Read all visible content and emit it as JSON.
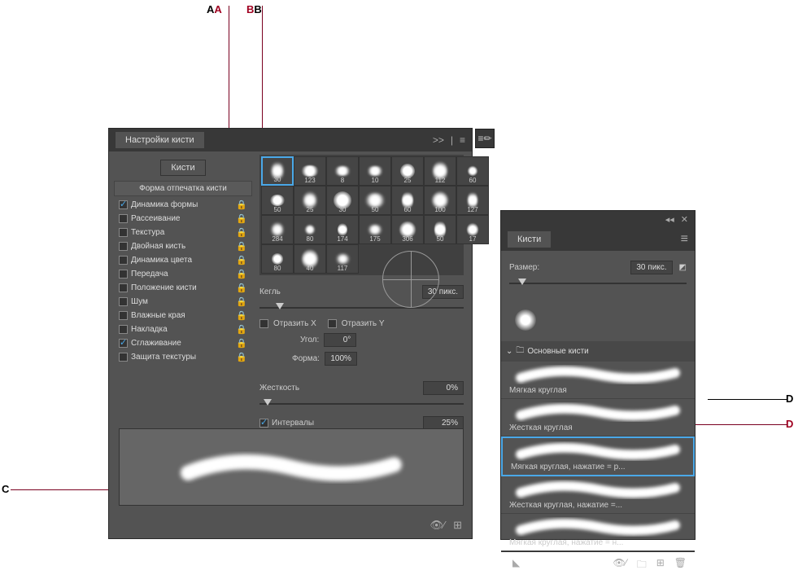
{
  "callouts": {
    "A": "A",
    "B": "B",
    "C": "C",
    "D": "D"
  },
  "panel1": {
    "title": "Настройки кисти",
    "buttons": {
      "kisti": "Кисти"
    },
    "tip_shape": "Форма отпечатка кисти",
    "options": [
      {
        "label": "Динамика формы",
        "checked": true
      },
      {
        "label": "Рассеивание",
        "checked": false
      },
      {
        "label": "Текстура",
        "checked": false
      },
      {
        "label": "Двойная кисть",
        "checked": false
      },
      {
        "label": "Динамика цвета",
        "checked": false
      },
      {
        "label": "Передача",
        "checked": false
      },
      {
        "label": "Положение кисти",
        "checked": false
      },
      {
        "label": "Шум",
        "checked": false
      },
      {
        "label": "Влажные края",
        "checked": false
      },
      {
        "label": "Накладка",
        "checked": false
      },
      {
        "label": "Сглаживание",
        "checked": true
      },
      {
        "label": "Защита текстуры",
        "checked": false
      }
    ],
    "brush_grid": [
      30,
      123,
      8,
      10,
      25,
      112,
      60,
      50,
      25,
      30,
      50,
      60,
      100,
      127,
      284,
      80,
      174,
      175,
      306,
      50,
      17,
      80,
      40,
      117
    ],
    "size": {
      "label": "Кегль",
      "value": "30 пикс."
    },
    "flip_x": "Отразить X",
    "flip_y": "Отразить Y",
    "angle": {
      "label": "Угол:",
      "value": "0°"
    },
    "shape": {
      "label": "Форма:",
      "value": "100%"
    },
    "hardness": {
      "label": "Жесткость",
      "value": "0%"
    },
    "spacing": {
      "label": "Интервалы",
      "value": "25%"
    }
  },
  "panel2": {
    "title": "Кисти",
    "size": {
      "label": "Размер:",
      "value": "30 пикс."
    },
    "folder": "Основные кисти",
    "presets": [
      {
        "label": "Мягкая круглая",
        "sel": false
      },
      {
        "label": "Жесткая круглая",
        "sel": false
      },
      {
        "label": "Мягкая круглая, нажатие = р...",
        "sel": true
      },
      {
        "label": "Жесткая круглая, нажатие =...",
        "sel": false
      },
      {
        "label": "Мягкая круглая, нажатие = н...",
        "sel": false
      }
    ]
  }
}
